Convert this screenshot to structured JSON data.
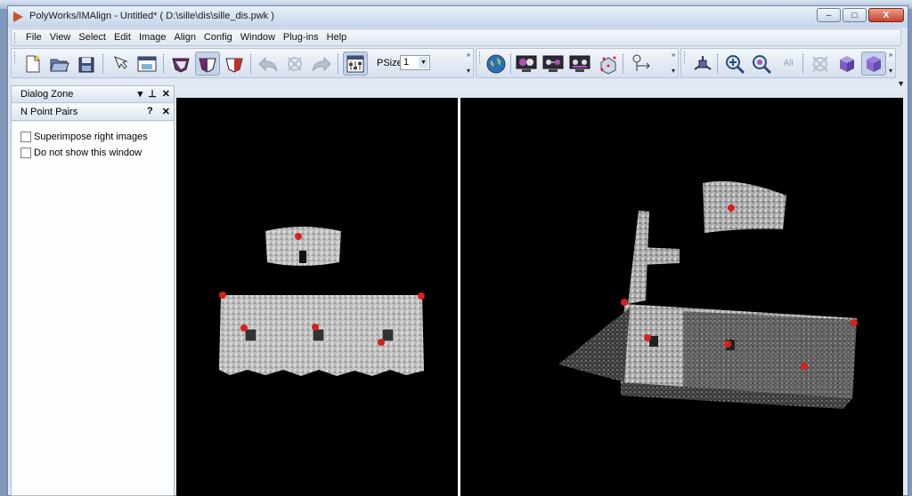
{
  "window": {
    "title": "PolyWorks/IMAlign - Untitled* ( D:\\sille\\dis\\sille_dis.pwk )",
    "controls": {
      "minimize": "–",
      "maximize": "□",
      "close": "X"
    }
  },
  "menubar": {
    "items": [
      "File",
      "View",
      "Select",
      "Edit",
      "Image",
      "Align",
      "Config",
      "Window",
      "Plug-ins",
      "Help"
    ]
  },
  "toolbar": {
    "psize_label": "PSize",
    "psize_value": "1",
    "zoom_all_label": "All",
    "icons": [
      "new-project-icon",
      "open-project-icon",
      "save-project-icon",
      "pick-icon",
      "image-window-icon",
      "shape-mode-1-icon",
      "shape-mode-2-icon",
      "shape-mode-3-icon",
      "undo-icon",
      "reset-icon",
      "redo-icon",
      "parameters-icon",
      "world-icon",
      "display-1-icon",
      "display-2-icon",
      "display-3-icon",
      "points-cloud-icon",
      "transform-axes-icon",
      "view-axes-icon",
      "zoom-in-icon",
      "zoom-select-icon",
      "zoom-all-icon",
      "hidden-lines-icon",
      "shaded-cube-icon",
      "flat-cube-icon"
    ]
  },
  "dock": {
    "title": "Dialog Zone",
    "controls": {
      "dropdown": "▾",
      "pin": "⊥",
      "close": "✕"
    },
    "panel": {
      "title": "N Point Pairs",
      "help": "?",
      "close": "✕",
      "options": [
        {
          "label": "Superimpose right images",
          "checked": false
        },
        {
          "label": "Do not show this window",
          "checked": false
        }
      ]
    }
  },
  "colors": {
    "title_gradient_top": "#e9f0f9",
    "viewport_bg": "#000000",
    "point_marker": "#d91f1f",
    "close_button": "#c7432a"
  }
}
